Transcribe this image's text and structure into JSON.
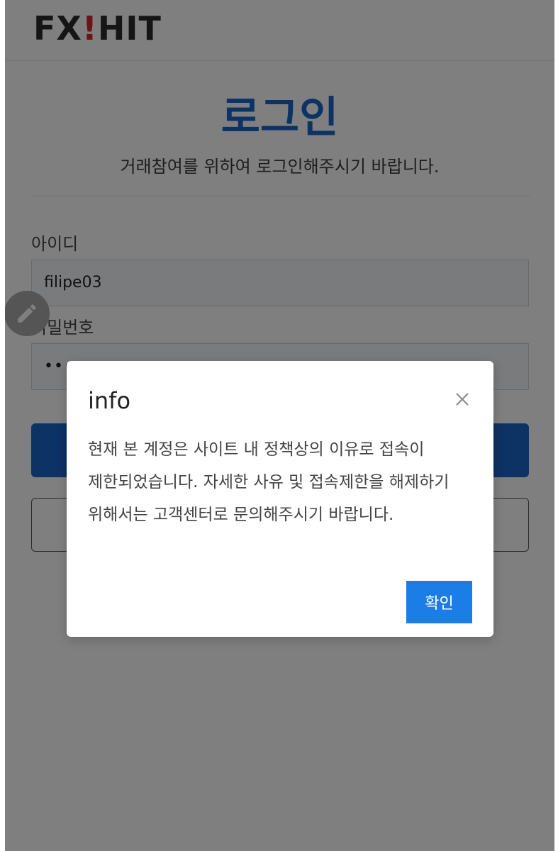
{
  "header": {
    "logo_prefix": "FX",
    "logo_bang": "!",
    "logo_suffix": "HIT"
  },
  "login": {
    "title": "로그인",
    "subtitle": "거래참여를 위하여 로그인해주시기 바랍니다.",
    "id_label": "아이디",
    "id_value": "filipe03",
    "password_label": "비밀번호",
    "password_value": "••••"
  },
  "modal": {
    "title": "info",
    "message": "현재 본 계정은 사이트 내 정책상의 이유로 접속이 제한되었습니다. 자세한 사유 및 접속제한을 해제하기 위해서는 고객센터로 문의해주시기 바랍니다.",
    "ok_label": "확인"
  },
  "colors": {
    "accent": "#1b64c8",
    "button_blue": "#1b7ee6",
    "logo_red": "#d9262b"
  },
  "icons": {
    "fab": "pencil-icon",
    "close": "close-icon"
  }
}
